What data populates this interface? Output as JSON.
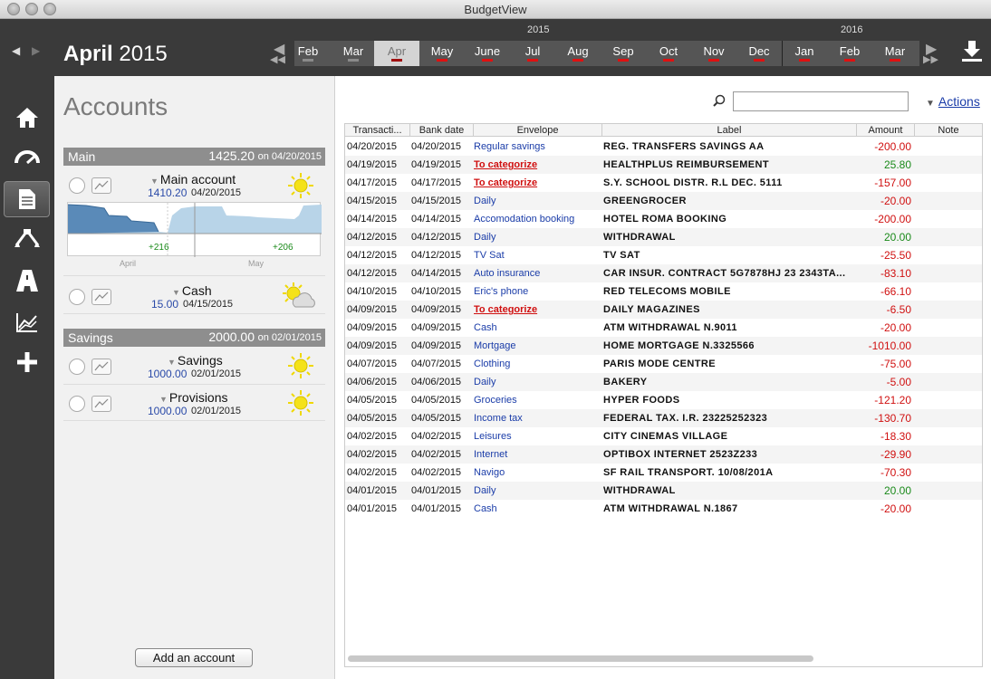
{
  "window": {
    "title": "BudgetView"
  },
  "header": {
    "month": "April",
    "year": "2015",
    "year_labels": [
      "2015",
      "2016"
    ],
    "months": [
      {
        "label": "Feb",
        "selected": false
      },
      {
        "label": "Mar",
        "selected": false
      },
      {
        "label": "Apr",
        "selected": true
      },
      {
        "label": "May",
        "selected": false
      },
      {
        "label": "June",
        "selected": false
      },
      {
        "label": "Jul",
        "selected": false
      },
      {
        "label": "Aug",
        "selected": false
      },
      {
        "label": "Sep",
        "selected": false
      },
      {
        "label": "Oct",
        "selected": false
      },
      {
        "label": "Nov",
        "selected": false
      },
      {
        "label": "Dec",
        "selected": false
      },
      {
        "label": "Jan",
        "selected": false
      },
      {
        "label": "Feb",
        "selected": false
      },
      {
        "label": "Mar",
        "selected": false
      }
    ]
  },
  "sidebar": {
    "icons": [
      "home-icon",
      "dashboard-icon",
      "document-icon",
      "split-icon",
      "road-icon",
      "chart-icon",
      "plus-icon"
    ],
    "active": "document-icon"
  },
  "accounts": {
    "title": "Accounts",
    "main_group": {
      "name": "Main",
      "amount": "1425.20",
      "on": "on 04/20/2015"
    },
    "main_account": {
      "name": "Main account",
      "amount": "1410.20",
      "date": "04/20/2015",
      "weather": "sun-icon",
      "graph_labels": [
        "+216",
        "+206"
      ],
      "graph_months": [
        "April",
        "May"
      ]
    },
    "cash": {
      "name": "Cash",
      "amount": "15.00",
      "date": "04/15/2015",
      "weather": "sun-cloud-icon"
    },
    "savings_group": {
      "name": "Savings",
      "amount": "2000.00",
      "on": "on 02/01/2015"
    },
    "savings": {
      "name": "Savings",
      "amount": "1000.00",
      "date": "02/01/2015",
      "weather": "sun-icon"
    },
    "provisions": {
      "name": "Provisions",
      "amount": "1000.00",
      "date": "02/01/2015",
      "weather": "sun-icon"
    },
    "add_label": "Add an account"
  },
  "main": {
    "search_placeholder": "",
    "actions_label": "Actions",
    "columns": [
      "Transacti...",
      "Bank date",
      "Envelope",
      "Label",
      "Amount",
      "Note"
    ],
    "rows": [
      {
        "tdate": "04/20/2015",
        "bdate": "04/20/2015",
        "envelope": "Regular savings",
        "label": "REG. TRANSFERS SAVINGS AA",
        "amount": "-200.00"
      },
      {
        "tdate": "04/19/2015",
        "bdate": "04/19/2015",
        "envelope": "To categorize",
        "label": "HEALTHPLUS REIMBURSEMENT",
        "amount": "25.80"
      },
      {
        "tdate": "04/17/2015",
        "bdate": "04/17/2015",
        "envelope": "To categorize",
        "label": "S.Y. SCHOOL DISTR. R.L DEC. 5111",
        "amount": "-157.00"
      },
      {
        "tdate": "04/15/2015",
        "bdate": "04/15/2015",
        "envelope": "Daily",
        "label": "GREENGROCER",
        "amount": "-20.00"
      },
      {
        "tdate": "04/14/2015",
        "bdate": "04/14/2015",
        "envelope": "Accomodation booking",
        "label": "HOTEL ROMA BOOKING",
        "amount": "-200.00"
      },
      {
        "tdate": "04/12/2015",
        "bdate": "04/12/2015",
        "envelope": "Daily",
        "label": "WITHDRAWAL",
        "amount": "20.00"
      },
      {
        "tdate": "04/12/2015",
        "bdate": "04/12/2015",
        "envelope": "TV Sat",
        "label": "TV SAT",
        "amount": "-25.50"
      },
      {
        "tdate": "04/12/2015",
        "bdate": "04/14/2015",
        "envelope": "Auto insurance",
        "label": "CAR INSUR. CONTRACT 5G7878HJ 23 2343TA...",
        "amount": "-83.10"
      },
      {
        "tdate": "04/10/2015",
        "bdate": "04/10/2015",
        "envelope": "Eric's phone",
        "label": "RED TELECOMS MOBILE",
        "amount": "-66.10"
      },
      {
        "tdate": "04/09/2015",
        "bdate": "04/09/2015",
        "envelope": "To categorize",
        "label": "DAILY MAGAZINES",
        "amount": "-6.50"
      },
      {
        "tdate": "04/09/2015",
        "bdate": "04/09/2015",
        "envelope": "Cash",
        "label": "ATM WITHDRAWAL N.9011",
        "amount": "-20.00"
      },
      {
        "tdate": "04/09/2015",
        "bdate": "04/09/2015",
        "envelope": "Mortgage",
        "label": "HOME MORTGAGE N.3325566",
        "amount": "-1010.00"
      },
      {
        "tdate": "04/07/2015",
        "bdate": "04/07/2015",
        "envelope": "Clothing",
        "label": "PARIS MODE CENTRE",
        "amount": "-75.00"
      },
      {
        "tdate": "04/06/2015",
        "bdate": "04/06/2015",
        "envelope": "Daily",
        "label": "BAKERY",
        "amount": "-5.00"
      },
      {
        "tdate": "04/05/2015",
        "bdate": "04/05/2015",
        "envelope": "Groceries",
        "label": "HYPER FOODS",
        "amount": "-121.20"
      },
      {
        "tdate": "04/05/2015",
        "bdate": "04/05/2015",
        "envelope": "Income tax",
        "label": "FEDERAL TAX. I.R. 23225252323",
        "amount": "-130.70"
      },
      {
        "tdate": "04/02/2015",
        "bdate": "04/02/2015",
        "envelope": "Leisures",
        "label": "CITY CINEMAS VILLAGE",
        "amount": "-18.30"
      },
      {
        "tdate": "04/02/2015",
        "bdate": "04/02/2015",
        "envelope": "Internet",
        "label": "OPTIBOX INTERNET 2523Z233",
        "amount": "-29.90"
      },
      {
        "tdate": "04/02/2015",
        "bdate": "04/02/2015",
        "envelope": "Navigo",
        "label": "SF RAIL TRANSPORT. 10/08/201A",
        "amount": "-70.30"
      },
      {
        "tdate": "04/01/2015",
        "bdate": "04/01/2015",
        "envelope": "Daily",
        "label": "WITHDRAWAL",
        "amount": "20.00"
      },
      {
        "tdate": "04/01/2015",
        "bdate": "04/01/2015",
        "envelope": "Cash",
        "label": "ATM WITHDRAWAL N.1867",
        "amount": "-20.00"
      }
    ]
  },
  "colors": {
    "negative": "#d01010",
    "positive": "#1a8a1a",
    "link": "#1a3ca8",
    "uncategorized": "#d01010"
  }
}
